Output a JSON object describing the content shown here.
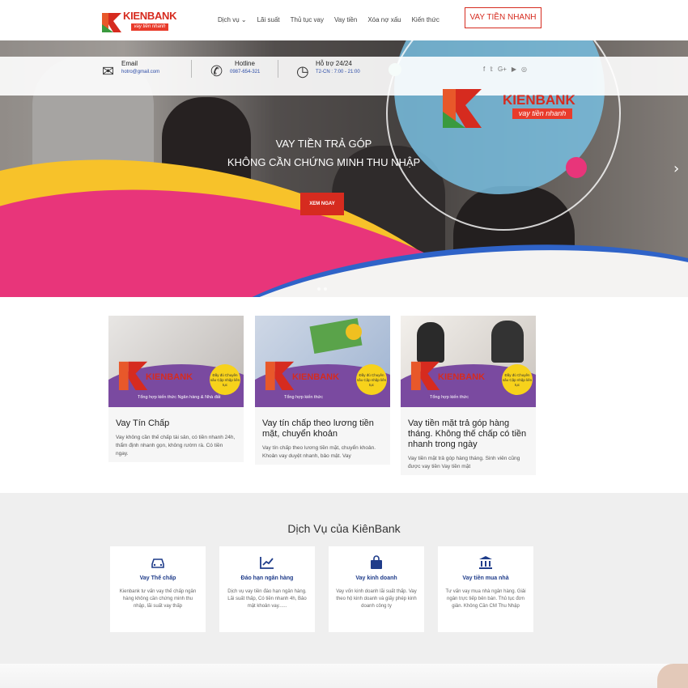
{
  "header": {
    "logo_brand": "KIENBANK",
    "logo_tagline": "vay tiền nhanh",
    "nav": [
      "Dịch vụ ⌄",
      "Lãi suất",
      "Thủ tục vay",
      "Vay tiền",
      "Xóa nợ xấu",
      "Kiến thức"
    ],
    "cta_label": "VAY TIỀN NHANH"
  },
  "infobar": {
    "email_title": "Email",
    "email_value": "hotro@gmail.com",
    "hotline_title": "Hotline",
    "hotline_value": "0987-654-321",
    "support_title": "Hỗ trợ 24/24",
    "support_value": "T2-CN : 7:00 - 21:00",
    "social_icons": [
      "f",
      "𝕥",
      "G+",
      "▶",
      "◎"
    ]
  },
  "hero": {
    "title_line1": "VAY TIỀN TRẢ GÓP",
    "title_line2": "KHÔNG CẦN CHỨNG MINH THU NHẬP",
    "button_label": "XEM NGAY",
    "logo_brand": "KIENBANK",
    "logo_tagline": "vay tiền nhanh",
    "arrow": "›"
  },
  "cards": [
    {
      "title": "Vay Tín Chấp",
      "desc": "Vay không cần thế chấp tài sản, có tiền nhanh 24h, thẩm định nhanh gọn, không rườm rà. Có tiền ngay.",
      "thumb_brand": "KIENBANK",
      "thumb_sub": "Tổng hợp kiến thức Ngân hàng & Nhà đất",
      "thumb_badge": "Đầy đủ Chuyên sâu Cập nhập liên tục"
    },
    {
      "title": "Vay tín chấp theo lương tiền mặt, chuyển khoản",
      "desc": "Vay tín chấp theo lương tiền mặt, chuyển khoản. Khoản vay duyệt nhanh, bảo mật. Vay",
      "thumb_brand": "KIENBANK",
      "thumb_sub": "Tổng hợp kiến thức",
      "thumb_badge": "Đầy đủ Chuyên sâu Cập nhập liên tục"
    },
    {
      "title": "Vay tiền mặt trả góp hàng tháng. Không thế chấp có tiền nhanh trong ngày",
      "desc": "Vay tiền mặt trả góp hàng tháng. Sinh viên cũng được vay tiền Vay tiền mặt",
      "thumb_brand": "KIENBANK",
      "thumb_sub": "Tổng hợp kiến thức",
      "thumb_badge": "Đầy đủ Chuyên sâu Cập nhập liên tục"
    }
  ],
  "services": {
    "heading": "Dịch Vụ của KiênBank",
    "items": [
      {
        "icon": "car-icon",
        "title": "Vay Thế chấp",
        "desc": "Kienbank tư vấn vay thế chấp ngân hàng không cần chứng minh thu nhập, lãi suất vay thấp"
      },
      {
        "icon": "chart-icon",
        "title": "Đáo hạn ngân hàng",
        "desc": "Dịch vụ vay tiền đáo hạn ngân hàng. Lãi suất thấp, Có tiền nhanh 4h, Bảo mật khoản vay......"
      },
      {
        "icon": "bag-icon",
        "title": "Vay kinh doanh",
        "desc": "Vay vốn kinh doanh lãi suất thấp. Vay theo hộ kinh doanh và giấy phép kinh doanh công ty"
      },
      {
        "icon": "bank-icon",
        "title": "Vay tiền mua nhà",
        "desc": "Tư vấn vay mua nhà ngân hàng. Giải ngân trực tiếp bên bán. Thủ tục đơn giản. Không Cần CM Thu Nhập"
      }
    ]
  },
  "colors": {
    "brand_red": "#d62b1f",
    "navy": "#1f3c8a"
  }
}
